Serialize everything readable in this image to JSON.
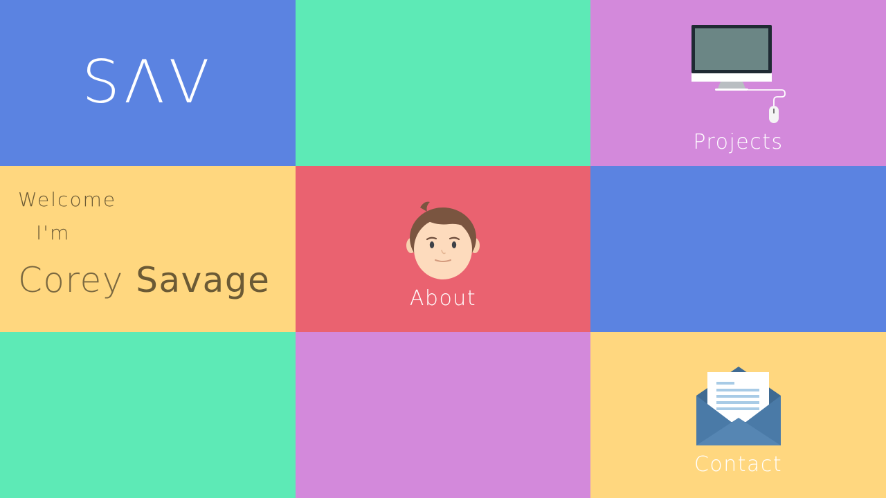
{
  "logo": {
    "text": "SΛV"
  },
  "intro": {
    "welcome": "Welcome",
    "im": "I'm",
    "first_name": "Corey",
    "last_name": "Savage"
  },
  "nav": {
    "projects_label": "Projects",
    "about_label": "About",
    "contact_label": "Contact"
  },
  "icons": {
    "projects": "monitor-icon",
    "about": "face-avatar-icon",
    "contact": "envelope-icon"
  },
  "colors": {
    "blue": "#5b83e1",
    "green": "#5deab6",
    "purple": "#d389db",
    "yellow": "#ffd77f",
    "red": "#ea6270"
  }
}
